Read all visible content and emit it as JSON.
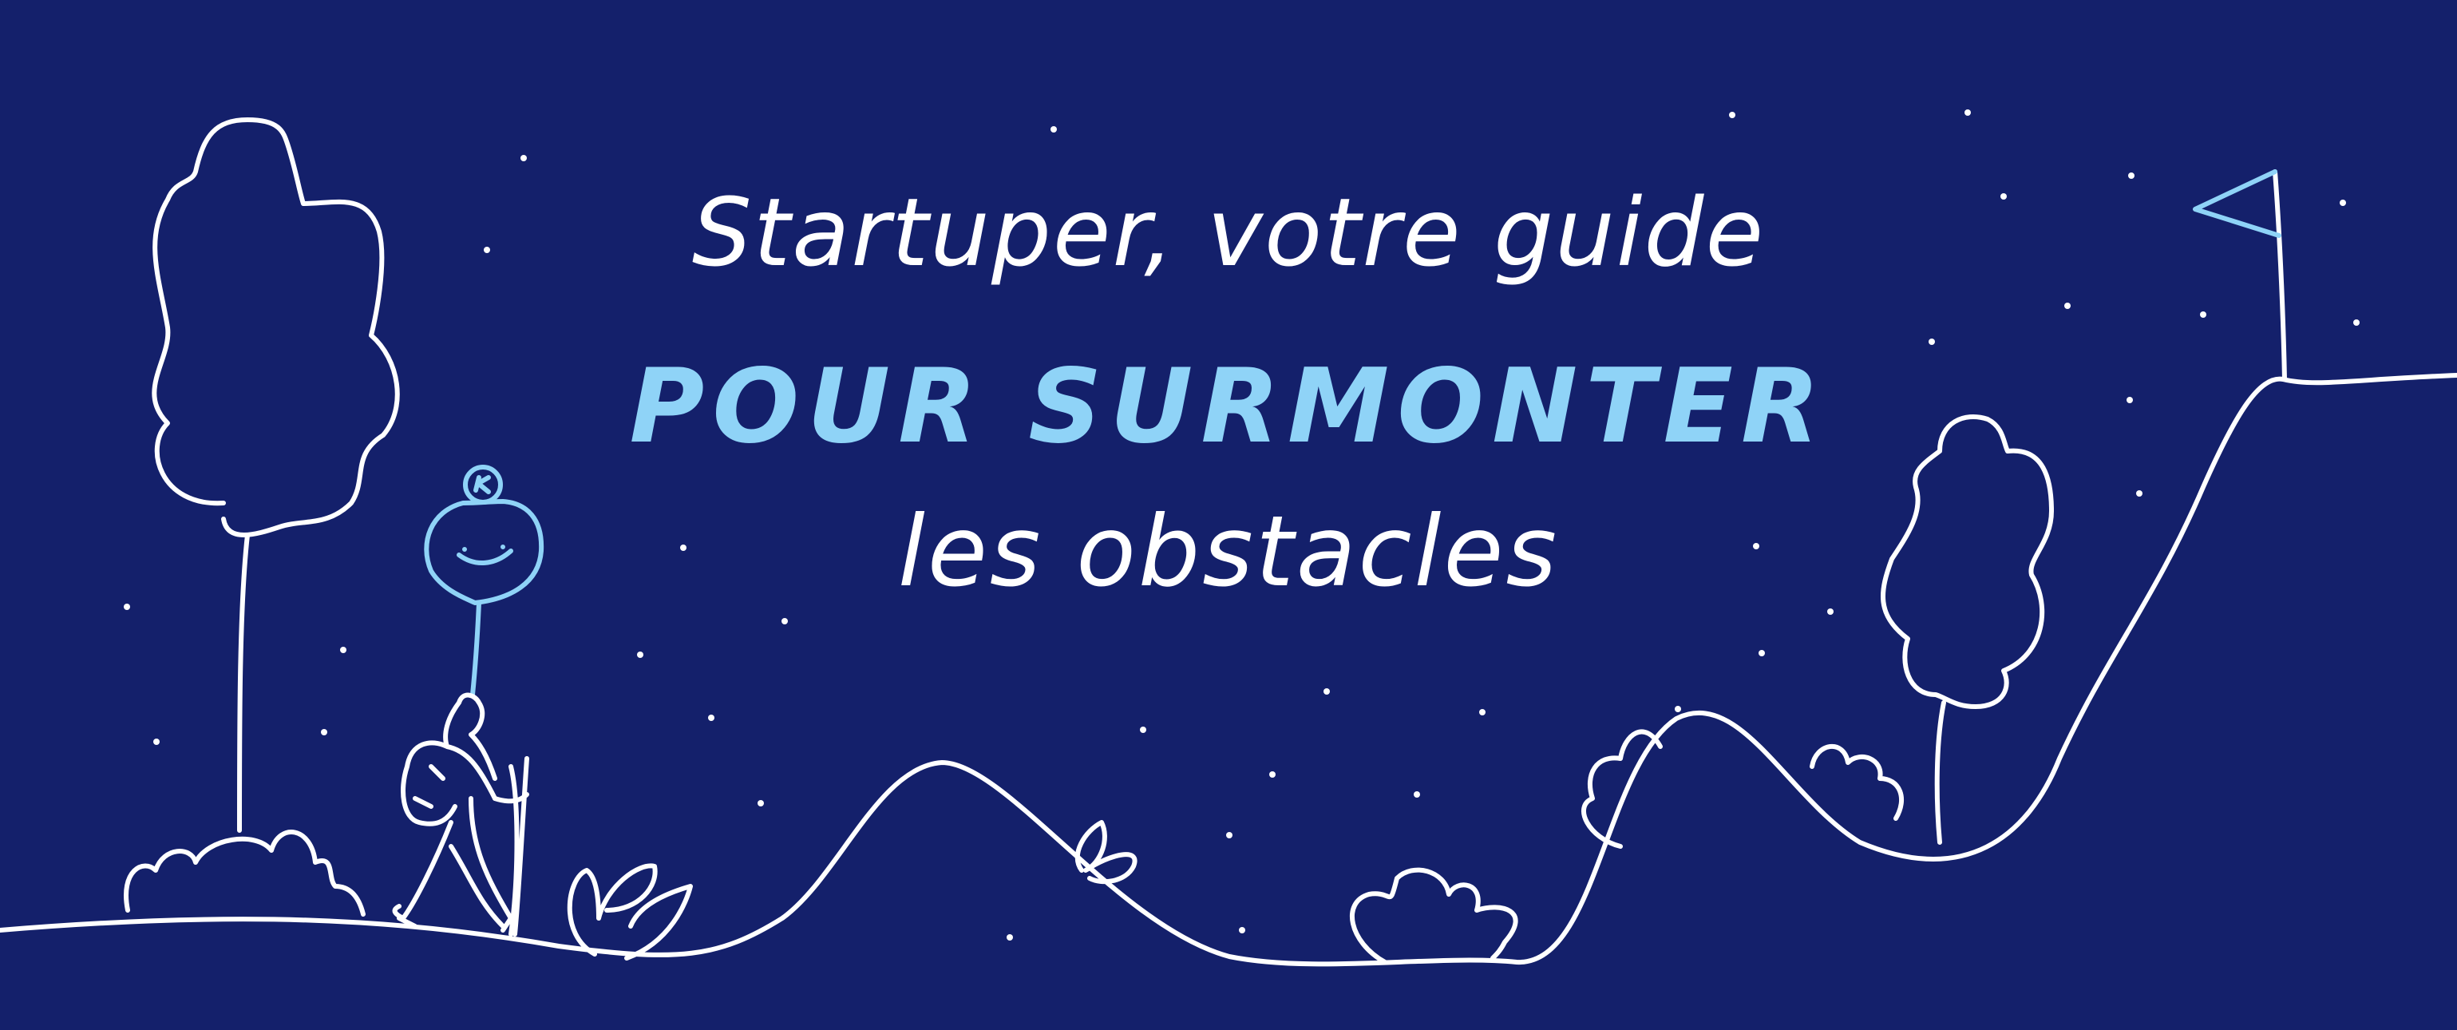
{
  "headline": {
    "line1": "Startuper, votre guide",
    "line2": "POUR SURMONTER",
    "line3": "les obstacles"
  },
  "colors": {
    "background": "#14206b",
    "line": "#ffffff",
    "accent": "#8fd3f7"
  },
  "illustration": {
    "figure_badge_letter": "K"
  }
}
